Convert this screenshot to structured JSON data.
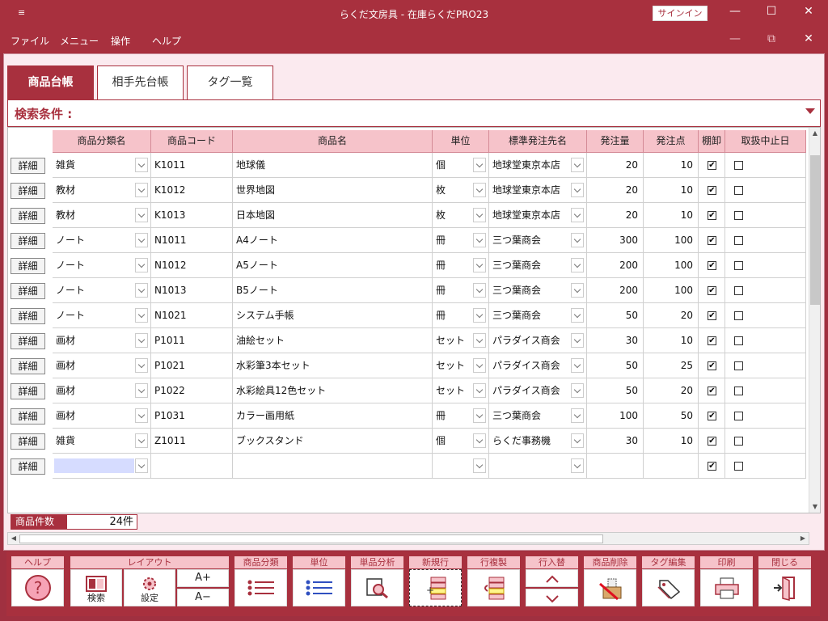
{
  "titlebar": {
    "qa_icon": "≡",
    "title": "らくだ文房具 - 在庫らくだPRO23",
    "signin": "サインイン",
    "min": "—",
    "max": "☐",
    "close": "✕"
  },
  "menu": {
    "items": [
      "ファイル",
      "メニュー",
      "操作",
      "ヘルプ"
    ],
    "min": "—",
    "restore": "⧉",
    "close": "✕"
  },
  "tabs": [
    "商品台帳",
    "相手先台帳",
    "タグ一覧"
  ],
  "search": {
    "label": "検索条件 :"
  },
  "grid": {
    "headers": [
      "商品分類名",
      "商品コード",
      "商品名",
      "単位",
      "標準発注先名",
      "発注量",
      "発注点",
      "棚卸",
      "取扱中止日"
    ],
    "detail_label": "詳細",
    "rows": [
      {
        "cat": "雑貨",
        "code": "K1011",
        "name": "地球儀",
        "unit": "個",
        "supplier": "地球堂東京本店",
        "qty": "20",
        "point": "10",
        "inv": true,
        "stop": false
      },
      {
        "cat": "教材",
        "code": "K1012",
        "name": "世界地図",
        "unit": "枚",
        "supplier": "地球堂東京本店",
        "qty": "20",
        "point": "10",
        "inv": true,
        "stop": false
      },
      {
        "cat": "教材",
        "code": "K1013",
        "name": "日本地図",
        "unit": "枚",
        "supplier": "地球堂東京本店",
        "qty": "20",
        "point": "10",
        "inv": true,
        "stop": false
      },
      {
        "cat": "ノート",
        "code": "N1011",
        "name": "A4ノート",
        "unit": "冊",
        "supplier": "三つ葉商会",
        "qty": "300",
        "point": "100",
        "inv": true,
        "stop": false
      },
      {
        "cat": "ノート",
        "code": "N1012",
        "name": "A5ノート",
        "unit": "冊",
        "supplier": "三つ葉商会",
        "qty": "200",
        "point": "100",
        "inv": true,
        "stop": false
      },
      {
        "cat": "ノート",
        "code": "N1013",
        "name": "B5ノート",
        "unit": "冊",
        "supplier": "三つ葉商会",
        "qty": "200",
        "point": "100",
        "inv": true,
        "stop": false
      },
      {
        "cat": "ノート",
        "code": "N1021",
        "name": "システム手帳",
        "unit": "冊",
        "supplier": "三つ葉商会",
        "qty": "50",
        "point": "20",
        "inv": true,
        "stop": false
      },
      {
        "cat": "画材",
        "code": "P1011",
        "name": "油絵セット",
        "unit": "セット",
        "supplier": "パラダイス商会",
        "qty": "30",
        "point": "10",
        "inv": true,
        "stop": false
      },
      {
        "cat": "画材",
        "code": "P1021",
        "name": "水彩筆3本セット",
        "unit": "セット",
        "supplier": "パラダイス商会",
        "qty": "50",
        "point": "25",
        "inv": true,
        "stop": false
      },
      {
        "cat": "画材",
        "code": "P1022",
        "name": "水彩絵具12色セット",
        "unit": "セット",
        "supplier": "パラダイス商会",
        "qty": "50",
        "point": "20",
        "inv": true,
        "stop": false
      },
      {
        "cat": "画材",
        "code": "P1031",
        "name": "カラー画用紙",
        "unit": "冊",
        "supplier": "三つ葉商会",
        "qty": "100",
        "point": "50",
        "inv": true,
        "stop": false
      },
      {
        "cat": "雑貨",
        "code": "Z1011",
        "name": "ブックスタンド",
        "unit": "個",
        "supplier": "らくだ事務機",
        "qty": "30",
        "point": "10",
        "inv": true,
        "stop": false
      },
      {
        "cat": "",
        "code": "",
        "name": "",
        "unit": "",
        "supplier": "",
        "qty": "",
        "point": "",
        "inv": true,
        "stop": false,
        "new": true
      }
    ]
  },
  "footer": {
    "count_label": "商品件数",
    "count_value": "24件"
  },
  "toolbar": {
    "groups": [
      {
        "label": "ヘルプ"
      },
      {
        "label": "レイアウト",
        "search": "検索",
        "settings": "設定",
        "font_up": "A+",
        "font_down": "A−"
      },
      {
        "label": "商品分類"
      },
      {
        "label": "単位"
      },
      {
        "label": "単品分析"
      },
      {
        "label": "新規行"
      },
      {
        "label": "行複製"
      },
      {
        "label": "行入替"
      },
      {
        "label": "商品削除"
      },
      {
        "label": "タグ編集"
      },
      {
        "label": "印刷"
      },
      {
        "label": "閉じる"
      }
    ]
  },
  "colors": {
    "accent": "#a8303e",
    "header_bg": "#f6c3ca",
    "panel_bg": "#fbeaef"
  }
}
